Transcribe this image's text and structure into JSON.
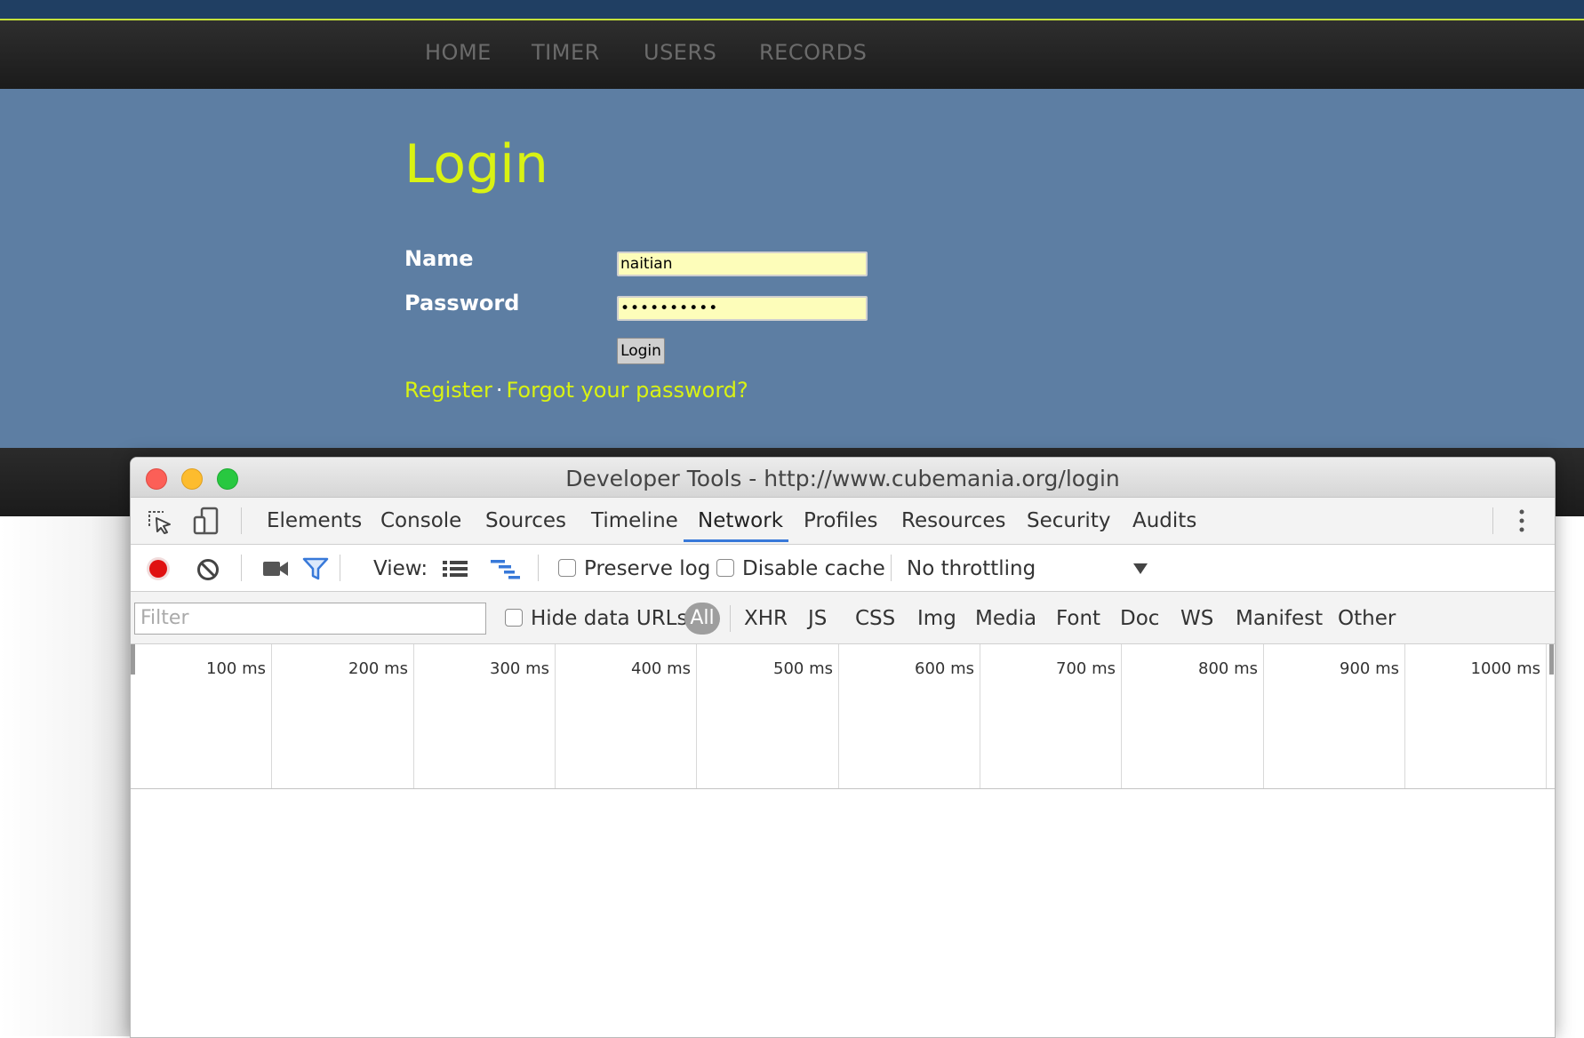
{
  "site": {
    "nav": [
      "HOME",
      "TIMER",
      "USERS",
      "RECORDS"
    ],
    "heading": "Login",
    "form": {
      "name_label": "Name",
      "name_value": "naitian",
      "password_label": "Password",
      "password_value": "••••••••••",
      "submit_label": "Login"
    },
    "links": {
      "register": "Register",
      "separator": "·",
      "forgot": "Forgot your password?"
    }
  },
  "devtools": {
    "window_title": "Developer Tools - http://www.cubemania.org/login",
    "tabs": [
      "Elements",
      "Console",
      "Sources",
      "Timeline",
      "Network",
      "Profiles",
      "Resources",
      "Security",
      "Audits"
    ],
    "active_tab": "Network",
    "toolbar": {
      "record_icon": "record-icon",
      "clear_icon": "clear-icon",
      "capture_icon": "camera-icon",
      "filter_icon": "funnel-icon",
      "view_label": "View:",
      "preserve_log": {
        "label": "Preserve log",
        "checked": false
      },
      "disable_cache": {
        "label": "Disable cache",
        "checked": false
      },
      "throttling": "No throttling"
    },
    "filter": {
      "placeholder": "Filter",
      "hide_data_urls": {
        "label": "Hide data URLs",
        "checked": false
      },
      "types": [
        "All",
        "XHR",
        "JS",
        "CSS",
        "Img",
        "Media",
        "Font",
        "Doc",
        "WS",
        "Manifest",
        "Other"
      ],
      "active_type": "All"
    },
    "timeline_ticks": [
      "100 ms",
      "200 ms",
      "300 ms",
      "400 ms",
      "500 ms",
      "600 ms",
      "700 ms",
      "800 ms",
      "900 ms",
      "1000 ms"
    ]
  },
  "colors": {
    "accent": "#d9f213",
    "page_bg": "#5d7ea3",
    "navbar": "#1f1f1f",
    "top_strip": "#203f63",
    "devtools_active_tab": "#3879d9",
    "record": "#e01111",
    "input_bg": "#fdfdba"
  }
}
